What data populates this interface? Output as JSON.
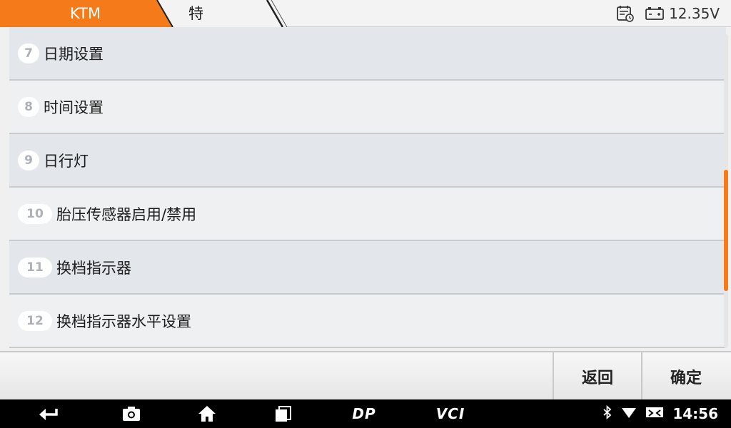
{
  "header": {
    "breadcrumb_1": "KTM",
    "breadcrumb_2": "特殊功能",
    "voltage": "12.35V",
    "accent_color": "#f47a1a"
  },
  "list": {
    "items": [
      {
        "number": "7",
        "label": "日期设置"
      },
      {
        "number": "8",
        "label": "时间设置"
      },
      {
        "number": "9",
        "label": "日行灯"
      },
      {
        "number": "10",
        "label": "胎压传感器启用/禁用"
      },
      {
        "number": "11",
        "label": "换档指示器"
      },
      {
        "number": "12",
        "label": "换档指示器水平设置"
      }
    ]
  },
  "actions": {
    "back_label": "返回",
    "confirm_label": "确定"
  },
  "navbar": {
    "dp_label": "DP",
    "vci_label": "VCI",
    "time": "14:56"
  },
  "icons": {
    "calendar": "calendar-clock-icon",
    "battery": "car-battery-icon",
    "back": "back-arrow-icon",
    "camera": "camera-icon",
    "home": "home-icon",
    "recents": "recents-icon",
    "bluetooth": "bluetooth-icon",
    "wifi": "wifi-icon",
    "sim": "sim-icon"
  }
}
